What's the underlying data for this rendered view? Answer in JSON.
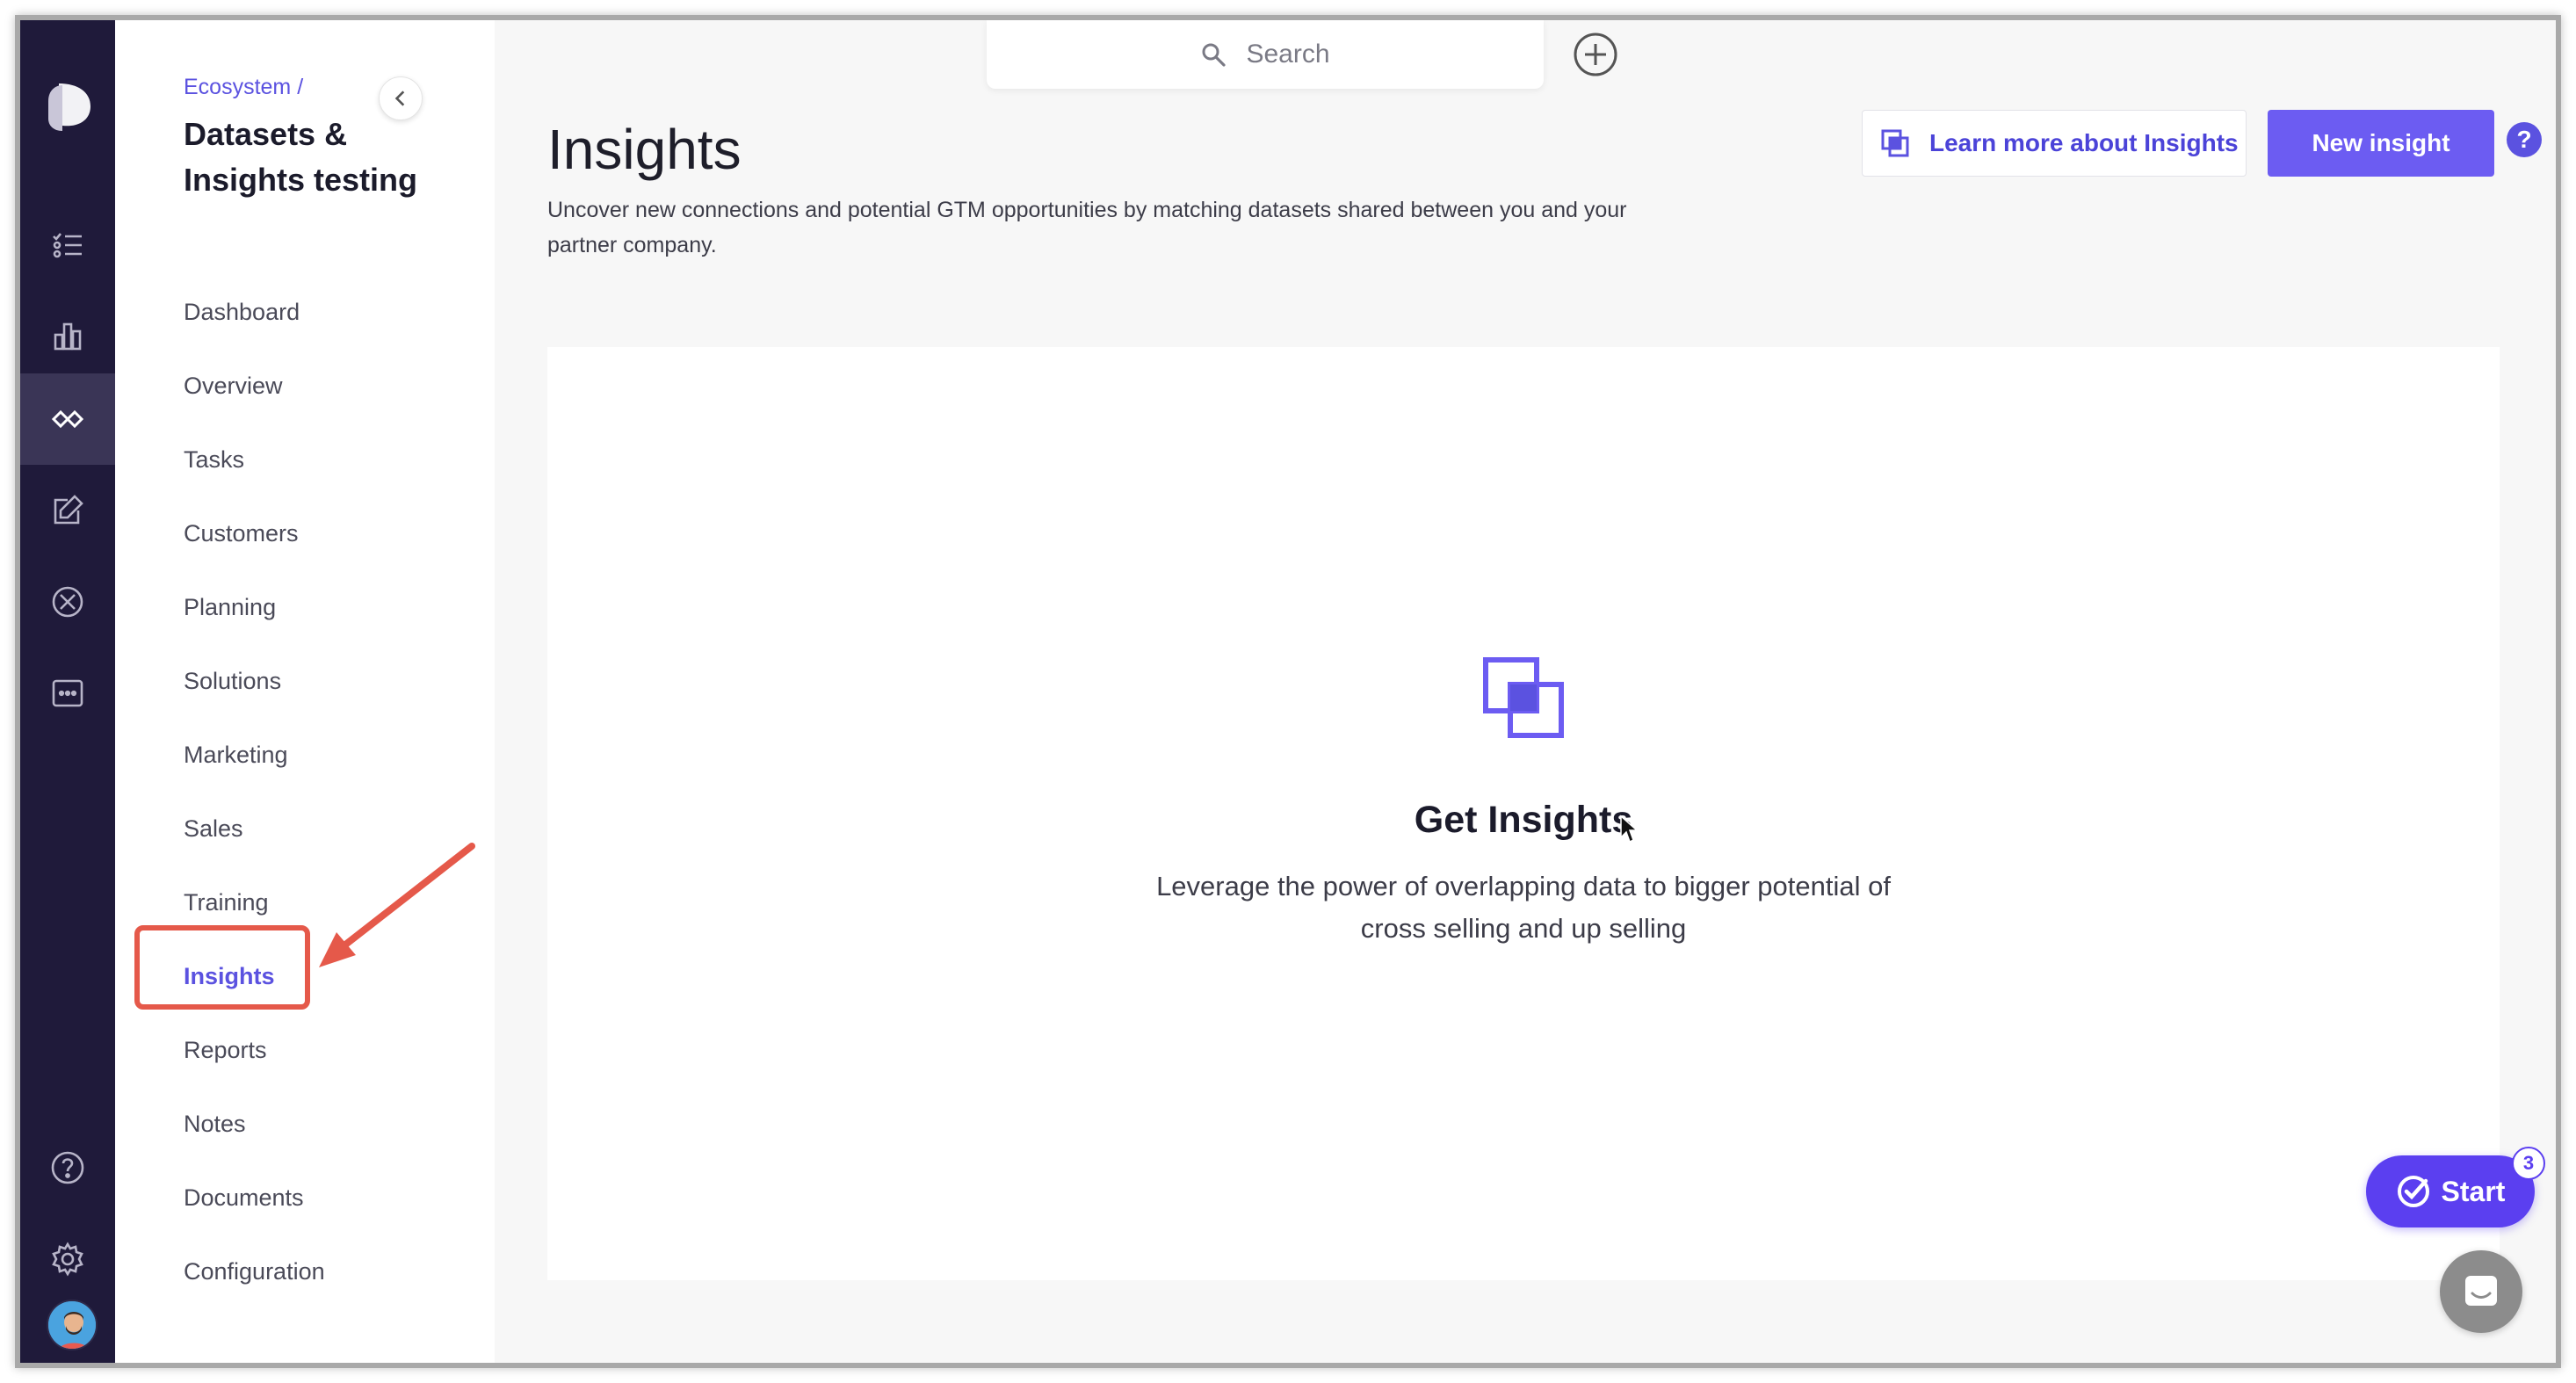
{
  "breadcrumb": {
    "parent": "Ecosystem /"
  },
  "project": {
    "title": "Datasets & Insights testing"
  },
  "sidebar": {
    "items": [
      {
        "label": "Dashboard"
      },
      {
        "label": "Overview"
      },
      {
        "label": "Tasks"
      },
      {
        "label": "Customers"
      },
      {
        "label": "Planning"
      },
      {
        "label": "Solutions"
      },
      {
        "label": "Marketing"
      },
      {
        "label": "Sales"
      },
      {
        "label": "Training"
      },
      {
        "label": "Insights",
        "active": true
      },
      {
        "label": "Reports"
      },
      {
        "label": "Notes"
      },
      {
        "label": "Documents"
      },
      {
        "label": "Configuration"
      }
    ]
  },
  "rail": {
    "icons": [
      "logo-icon",
      "tasks-icon",
      "bar-chart-icon",
      "ecosystem-icon",
      "edit-icon",
      "compass-icon",
      "more-icon",
      "help-icon",
      "settings-icon"
    ],
    "active": "ecosystem-icon"
  },
  "search": {
    "placeholder": "Search"
  },
  "header": {
    "title": "Insights",
    "description": "Uncover new connections and potential GTM opportunities by matching datasets shared between you and your partner company.",
    "learn_more_label": "Learn more about Insights",
    "new_insight_label": "New insight",
    "help_label": "?"
  },
  "empty_state": {
    "title": "Get Insights",
    "description": "Leverage the power of overlapping data to bigger potential of cross selling and up selling"
  },
  "start_widget": {
    "label": "Start",
    "badge_count": "3"
  },
  "colors": {
    "accent": "#5b52e0",
    "primary_button": "#6c5cf2",
    "rail_bg": "#1f1a3a",
    "annotation": "#e5594a"
  }
}
